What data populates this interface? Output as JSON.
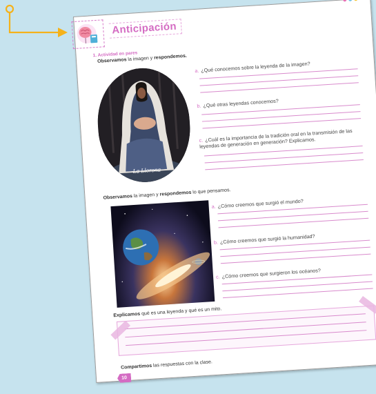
{
  "header": {
    "title": "Anticipación",
    "dot_colors": [
      "#e86fb4",
      "#6ec1e8",
      "#f4c430"
    ]
  },
  "activity": {
    "label": "1. Actividad en pares",
    "instruction_1": {
      "bold_a": "Observamos",
      "mid": " la imagen y ",
      "bold_b": "respondemos."
    },
    "image_1_caption": "La Llorona",
    "questions_1": [
      {
        "letter": "a.",
        "text": "¿Qué conocemos sobre la leyenda de la imagen?"
      },
      {
        "letter": "b.",
        "text": "¿Qué otras leyendas conocemos?"
      },
      {
        "letter": "c.",
        "text": "¿Cuál es la importancia de la tradición oral en la transmisión de las leyendas de generación en generación? Explicamos."
      }
    ],
    "instruction_2": {
      "bold_a": "Observamos",
      "mid": " la imagen y ",
      "bold_b": "respondemos",
      "end": " lo que pensamos."
    },
    "questions_2": [
      {
        "letter": "a.",
        "text": "¿Cómo creemos que surgió el mundo?"
      },
      {
        "letter": "b.",
        "text": "¿Cómo creemos que surgió la humanidad?"
      },
      {
        "letter": "c.",
        "text": "¿Cómo creemos que surgieron los océanos?"
      }
    ],
    "explain": {
      "bold": "Explicamos",
      "rest": " qué es una leyenda y qué es un mito."
    },
    "share": {
      "bold": "Compartimos",
      "rest": " las respuestas con la clase."
    }
  },
  "footer": {
    "page_number": "10"
  },
  "colors": {
    "accent": "#d46cc3",
    "connector": "#f5b21a",
    "background": "#c6e3ee"
  },
  "icons": [
    "brain-book-icon",
    "arrow-connector-icon"
  ]
}
